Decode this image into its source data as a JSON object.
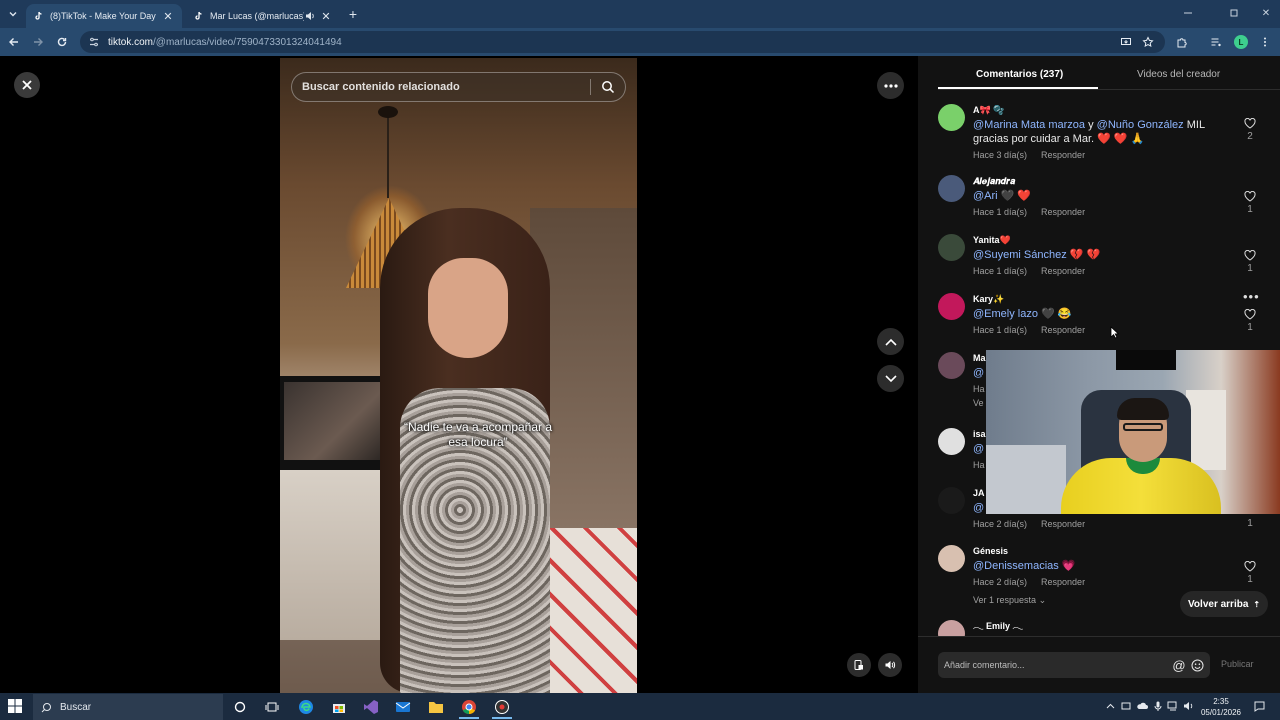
{
  "browser": {
    "tabs": [
      {
        "title": "(8)TikTok - Make Your Day",
        "active": true
      },
      {
        "title": "Mar Lucas (@marlucas) ofic",
        "active": false
      }
    ],
    "url_domain": "tiktok.com",
    "url_path": "/@marlucas/video/7590473301324041494",
    "profile_initial": "L"
  },
  "player": {
    "search_placeholder": "Buscar contenido relacionado",
    "caption_line1": "“Nadie te va a acompañar a",
    "caption_line2": "esa locura”"
  },
  "panel": {
    "tab_comments": "Comentarios (237)",
    "tab_creator": "Videos del creador",
    "back_to_top": "Volver arriba",
    "input_placeholder": "Añadir comentario...",
    "publish": "Publicar",
    "comments": [
      {
        "user": "A🎀 🫧",
        "avatar_color": "#7ad06a",
        "mention1": "@Marina Mata marzoa",
        "joiner": " y ",
        "mention2": "@Nuño González",
        "text": " MIL gracias por cuidar a Mar. ❤️ ❤️ 🙏",
        "time": "Hace 3 día(s)",
        "reply": "Responder",
        "likes": "2"
      },
      {
        "user": "𝑨𝒍𝒆𝒋𝒂𝒏𝒅𝒓𝒂",
        "avatar_color": "#4a5a7a",
        "mention1": "@Ari",
        "text": " 🖤 ❤️",
        "time": "Hace 1 día(s)",
        "reply": "Responder",
        "likes": "1"
      },
      {
        "user": "Yanita❤️",
        "avatar_color": "#3a4a3a",
        "mention1": "@Suyemi Sánchez",
        "text": " 💔 💔",
        "time": "Hace 1 día(s)",
        "reply": "Responder",
        "likes": "1"
      },
      {
        "user": "Kary✨",
        "avatar_color": "#c2185b",
        "mention1": "@Emely lazo",
        "text": " 🖤 😂",
        "time": "Hace 1 día(s)",
        "reply": "Responder",
        "likes": "1"
      },
      {
        "user": "Ma",
        "avatar_color": "#6a4a5a",
        "mention1": "@",
        "text": "",
        "time": "Ha",
        "reply": "",
        "likes": "",
        "partial_more": "Ve"
      },
      {
        "user": "isa",
        "avatar_color": "#e0e0e0",
        "mention1": "@",
        "text": "",
        "time": "Ha",
        "reply": "",
        "likes": ""
      },
      {
        "user": "JA",
        "avatar_color": "#1a1a1a",
        "mention1": "@",
        "text": "",
        "time": "Hace 2 día(s)",
        "reply": "Responder",
        "likes": "1"
      },
      {
        "user": "Génesis",
        "avatar_color": "#d8c0b0",
        "mention1": "@Denissemacias",
        "text": " 💗",
        "time": "Hace 2 día(s)",
        "reply": "Responder",
        "likes": "1",
        "more_replies": "Ver 1 respuesta"
      },
      {
        "user": "𓂃 Emily 𓂃",
        "avatar_color": "#c9a0a0",
        "mention1": "",
        "text": "",
        "time": "",
        "reply": "",
        "likes": ""
      }
    ]
  },
  "taskbar": {
    "search_placeholder": "Buscar",
    "time": "2:35",
    "date": "05/01/2026"
  },
  "colors": {
    "accent_heart": "#fe2c55",
    "mention": "#8fb6ff",
    "browser_frame": "#1f3a5a"
  }
}
